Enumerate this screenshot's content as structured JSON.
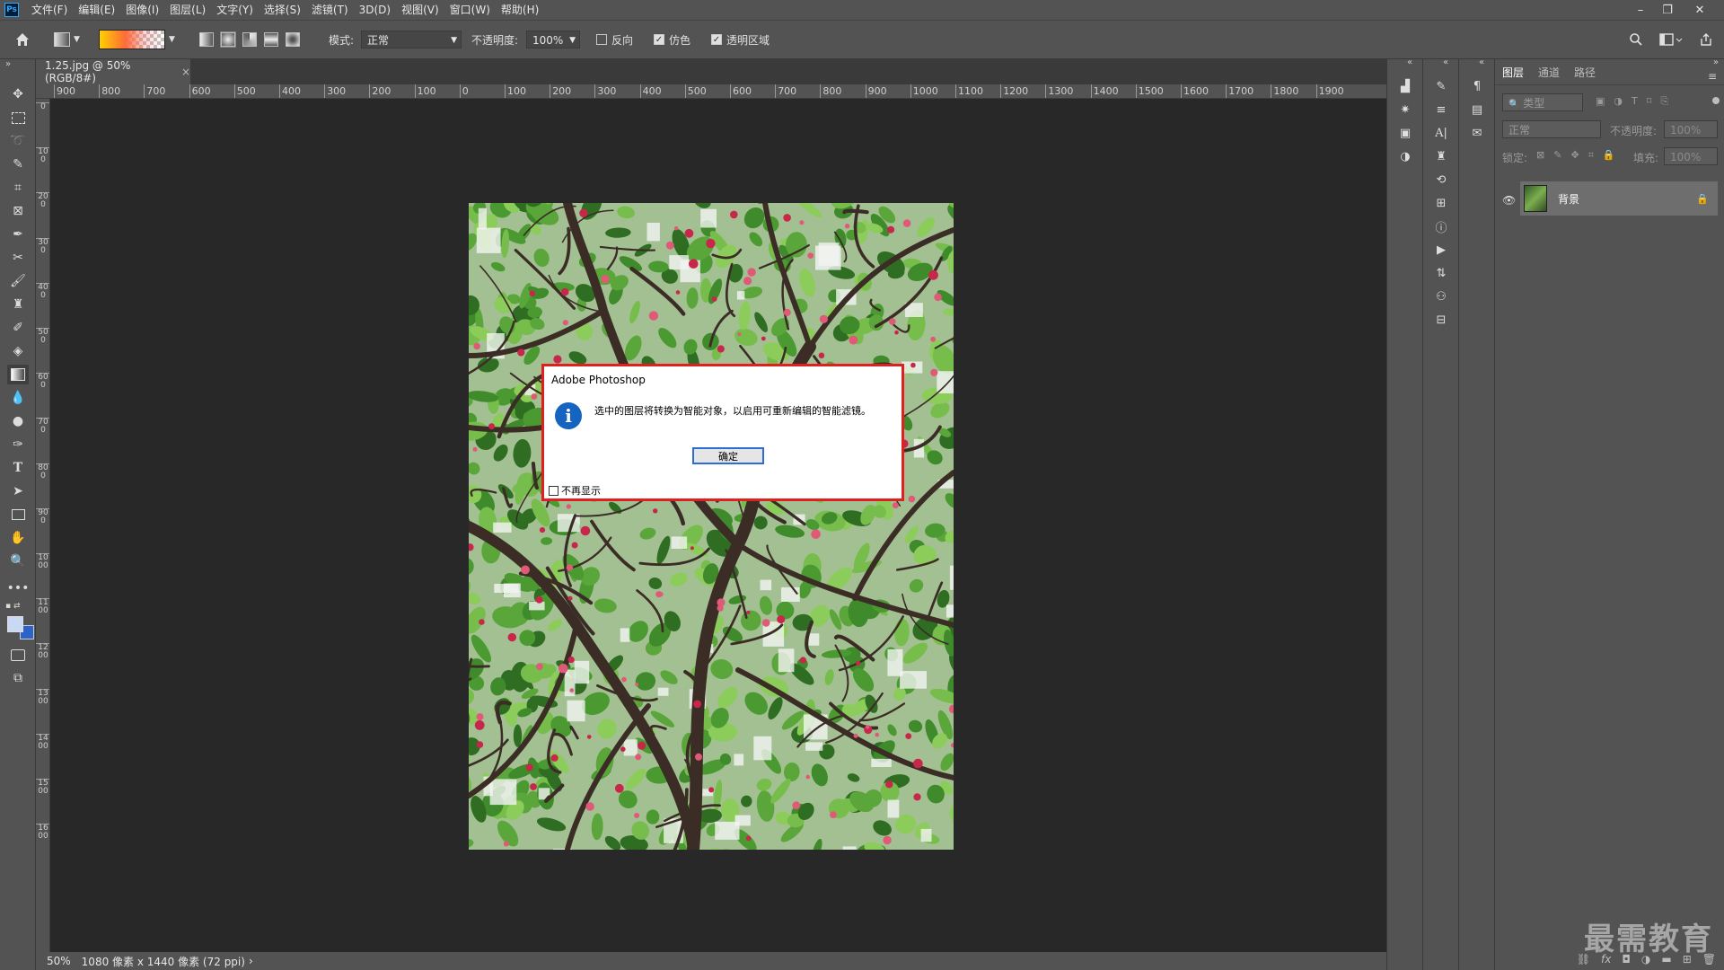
{
  "app": {
    "logo": "Ps"
  },
  "menu": [
    "文件(F)",
    "编辑(E)",
    "图像(I)",
    "图层(L)",
    "文字(Y)",
    "选择(S)",
    "滤镜(T)",
    "3D(D)",
    "视图(V)",
    "窗口(W)",
    "帮助(H)"
  ],
  "window_controls": {
    "minimize": "–",
    "restore": "❐",
    "close": "✕"
  },
  "options": {
    "mode_label": "模式:",
    "mode_value": "正常",
    "opacity_label": "不透明度:",
    "opacity_value": "100%",
    "reverse_label": "反向",
    "dither_label": "仿色",
    "transparency_label": "透明区域",
    "reverse_checked": false,
    "dither_checked": true,
    "transparency_checked": true
  },
  "document": {
    "tab_title": "1.25.jpg @ 50%(RGB/8#)",
    "tab_close": "×",
    "zoom": "50%",
    "info": "1080 像素 x 1440 像素 (72 ppi)",
    "info_arrow": "›"
  },
  "ruler": {
    "h_labels": [
      "900",
      "800",
      "700",
      "600",
      "500",
      "400",
      "300",
      "200",
      "100",
      "0",
      "100",
      "200",
      "300",
      "400",
      "500",
      "600",
      "700",
      "800",
      "900",
      "1000",
      "1100",
      "1200",
      "1300",
      "1400",
      "1500",
      "1600",
      "1700",
      "1800",
      "1900"
    ],
    "v_labels": [
      "0",
      "100",
      "200",
      "300",
      "400",
      "500",
      "600",
      "700",
      "800",
      "900",
      "1000",
      "1100",
      "1200",
      "1300",
      "1400",
      "1500",
      "1600"
    ]
  },
  "dialog": {
    "title": "Adobe Photoshop",
    "message": "选中的图层将转换为智能对象，以启用可重新编辑的智能滤镜。",
    "ok_label": "确定",
    "dont_show_label": "不再显示",
    "icon_glyph": "i",
    "dont_show_checked": false
  },
  "layers_panel": {
    "tabs": [
      "图层",
      "通道",
      "路径"
    ],
    "filter_placeholder": "类型",
    "blend_mode": "正常",
    "opacity_label": "不透明度:",
    "opacity_value": "100%",
    "lock_label": "锁定:",
    "fill_label": "填充:",
    "fill_value": "100%",
    "layers": [
      {
        "name": "背景",
        "visible": true,
        "locked": true
      }
    ]
  },
  "watermark": "最需教育",
  "colors": {
    "ui_panel": "#535353",
    "canvas_bg": "#282828",
    "dialog_border": "#e02020",
    "info_blue": "#1565c0"
  }
}
